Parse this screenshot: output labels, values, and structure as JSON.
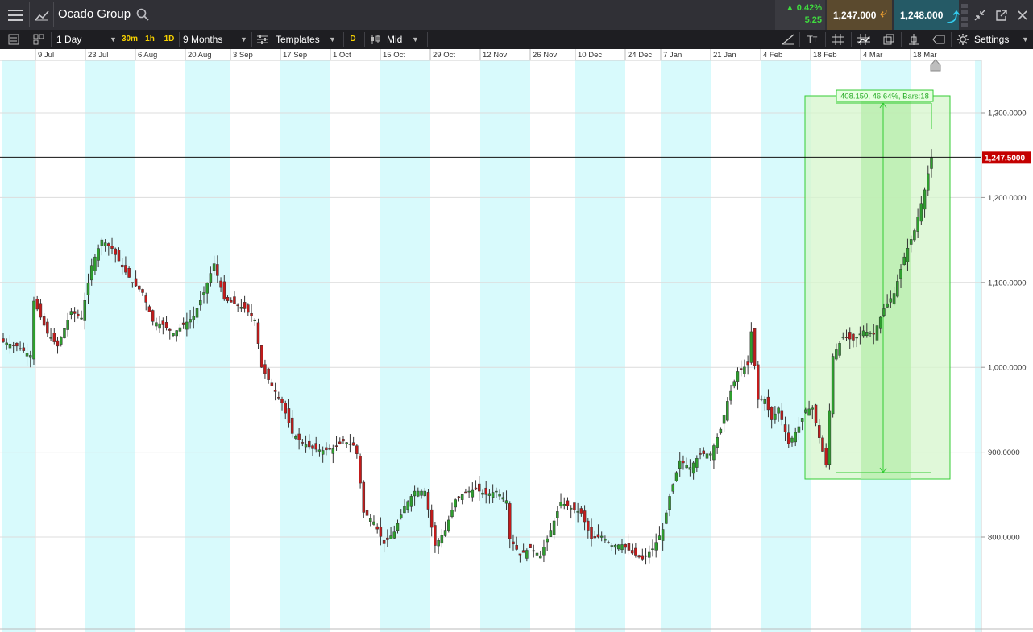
{
  "header": {
    "title": "Ocado Group",
    "change_pct": "0.42%",
    "change_abs": "5.25",
    "sell_price": "1,247.000",
    "buy_price": "1,248.000"
  },
  "toolbar": {
    "interval": "1 Day",
    "quick_intervals": [
      "30m",
      "1h",
      "1D"
    ],
    "range": "9 Months",
    "templates_label": "Templates",
    "d_label": "D",
    "price_type": "Mid",
    "settings_label": "Settings"
  },
  "colors": {
    "up": "#2e9e2e",
    "down": "#c21b1b",
    "band": "#d8fafc",
    "measure": "#33cc33",
    "price_tag": "#c40000"
  },
  "chart_data": {
    "type": "candlestick",
    "x_labels": [
      "9 Jul",
      "23 Jul",
      "6 Aug",
      "20 Aug",
      "3 Sep",
      "17 Sep",
      "1 Oct",
      "15 Oct",
      "29 Oct",
      "12 Nov",
      "26 Nov",
      "10 Dec",
      "24 Dec",
      "7 Jan",
      "21 Jan",
      "4 Feb",
      "18 Feb",
      "4 Mar",
      "18 Mar"
    ],
    "y_ticks": [
      "1,300.0000",
      "1,200.0000",
      "1,100.0000",
      "1,000.0000",
      "900.0000",
      "800.0000"
    ],
    "y_tick_values": [
      1300,
      1200,
      1100,
      1000,
      900,
      800
    ],
    "ylim": [
      727,
      1358
    ],
    "current_price": "1,247.5000",
    "current_price_value": 1247.5,
    "measure_label": "408.150, 46.64%, Bars:18",
    "measure_from": 874,
    "measure_to": 1281,
    "anchors": [
      [
        0,
        1030
      ],
      [
        4,
        1025
      ],
      [
        8,
        1014
      ],
      [
        9,
        1078
      ],
      [
        13,
        1040
      ],
      [
        16,
        1025
      ],
      [
        20,
        1066
      ],
      [
        23,
        1058
      ],
      [
        26,
        1120
      ],
      [
        29,
        1150
      ],
      [
        32,
        1140
      ],
      [
        35,
        1118
      ],
      [
        38,
        1100
      ],
      [
        41,
        1088
      ],
      [
        44,
        1054
      ],
      [
        47,
        1050
      ],
      [
        50,
        1040
      ],
      [
        53,
        1050
      ],
      [
        56,
        1060
      ],
      [
        59,
        1088
      ],
      [
        62,
        1122
      ],
      [
        65,
        1080
      ],
      [
        68,
        1075
      ],
      [
        71,
        1069
      ],
      [
        74,
        1056
      ],
      [
        76,
        1000
      ],
      [
        79,
        978
      ],
      [
        82,
        958
      ],
      [
        85,
        922
      ],
      [
        88,
        911
      ],
      [
        91,
        904
      ],
      [
        94,
        902
      ],
      [
        97,
        904
      ],
      [
        100,
        913
      ],
      [
        103,
        908
      ],
      [
        104,
        898
      ],
      [
        106,
        829
      ],
      [
        109,
        818
      ],
      [
        112,
        792
      ],
      [
        115,
        806
      ],
      [
        118,
        836
      ],
      [
        121,
        854
      ],
      [
        124,
        854
      ],
      [
        127,
        790
      ],
      [
        130,
        808
      ],
      [
        133,
        844
      ],
      [
        136,
        853
      ],
      [
        139,
        856
      ],
      [
        142,
        850
      ],
      [
        145,
        854
      ],
      [
        148,
        843
      ],
      [
        149,
        798
      ],
      [
        152,
        779
      ],
      [
        155,
        787
      ],
      [
        158,
        778
      ],
      [
        161,
        808
      ],
      [
        164,
        841
      ],
      [
        167,
        834
      ],
      [
        170,
        828
      ],
      [
        173,
        798
      ],
      [
        176,
        801
      ],
      [
        179,
        790
      ],
      [
        182,
        791
      ],
      [
        185,
        781
      ],
      [
        188,
        774
      ],
      [
        191,
        786
      ],
      [
        194,
        809
      ],
      [
        196,
        848
      ],
      [
        199,
        890
      ],
      [
        202,
        882
      ],
      [
        205,
        898
      ],
      [
        208,
        898
      ],
      [
        211,
        927
      ],
      [
        213,
        960
      ],
      [
        216,
        995
      ],
      [
        219,
        1003
      ],
      [
        220,
        1042
      ],
      [
        222,
        962
      ],
      [
        224,
        962
      ],
      [
        226,
        938
      ],
      [
        228,
        952
      ],
      [
        231,
        910
      ],
      [
        234,
        930
      ],
      [
        236,
        950
      ],
      [
        238,
        952
      ],
      [
        240,
        917
      ],
      [
        242,
        885
      ],
      [
        244,
        1013
      ],
      [
        247,
        1036
      ],
      [
        250,
        1032
      ],
      [
        253,
        1043
      ],
      [
        256,
        1039
      ],
      [
        259,
        1069
      ],
      [
        262,
        1087
      ],
      [
        265,
        1130
      ],
      [
        268,
        1161
      ],
      [
        271,
        1209
      ],
      [
        273,
        1247
      ]
    ]
  }
}
